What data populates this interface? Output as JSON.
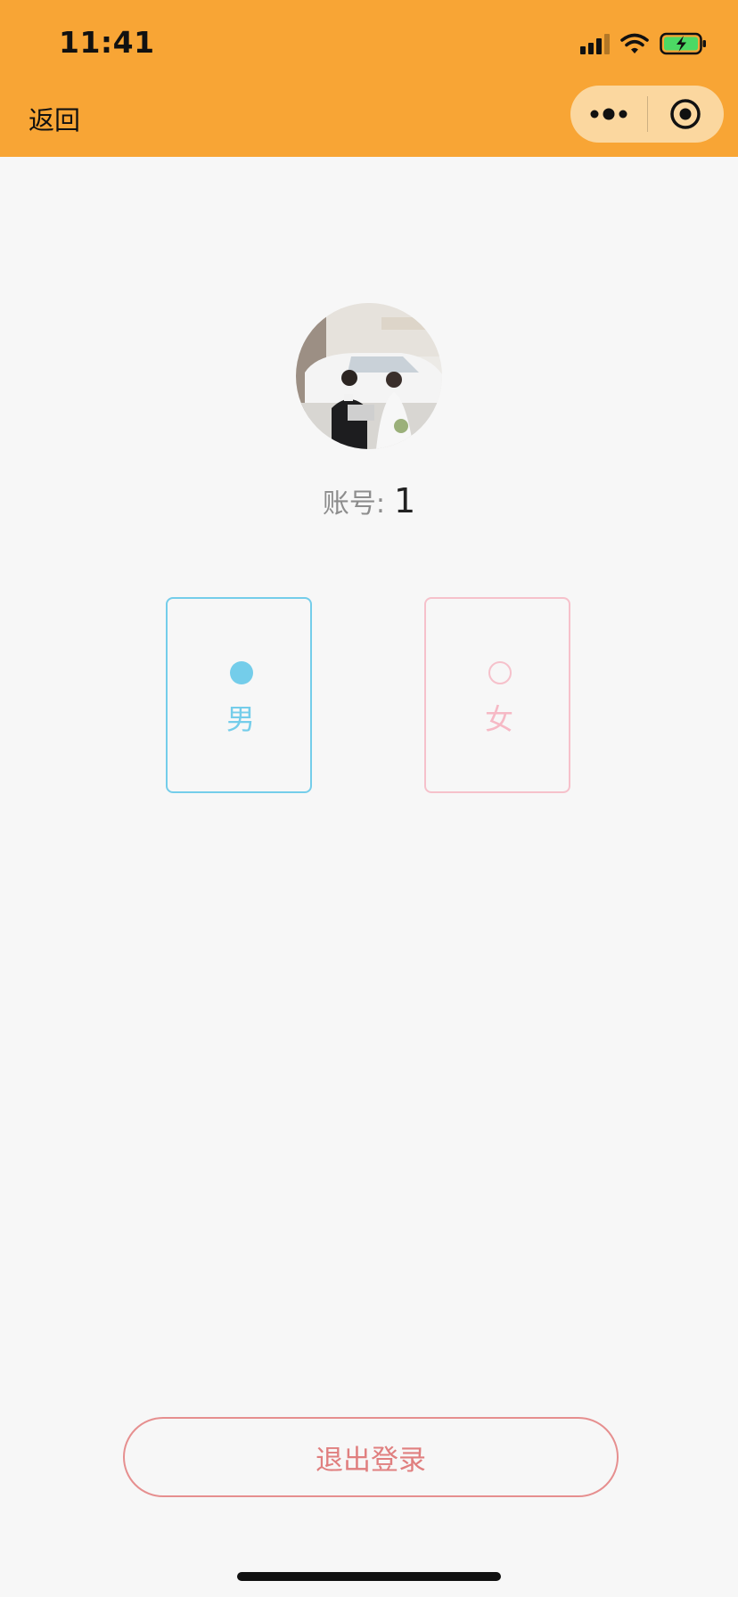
{
  "status_bar": {
    "time": "11:41"
  },
  "nav": {
    "back_label": "返回",
    "capsule_icons": [
      "more-dots-icon",
      "target-circle-icon"
    ]
  },
  "profile": {
    "account_label": "账号:",
    "account_value": "1",
    "avatar_icon": "avatar-photo"
  },
  "gender": {
    "options": [
      {
        "label": "男",
        "selected": true,
        "color": "#74cdea"
      },
      {
        "label": "女",
        "selected": false,
        "color": "#f6c1cb"
      }
    ]
  },
  "actions": {
    "logout_label": "退出登录"
  },
  "colors": {
    "header_bg": "#f8a535",
    "capsule_bg": "#fbd79f",
    "page_bg": "#f7f7f7",
    "male_accent": "#74cdea",
    "female_accent": "#f6c1cb",
    "logout_accent": "#e07f7f"
  }
}
